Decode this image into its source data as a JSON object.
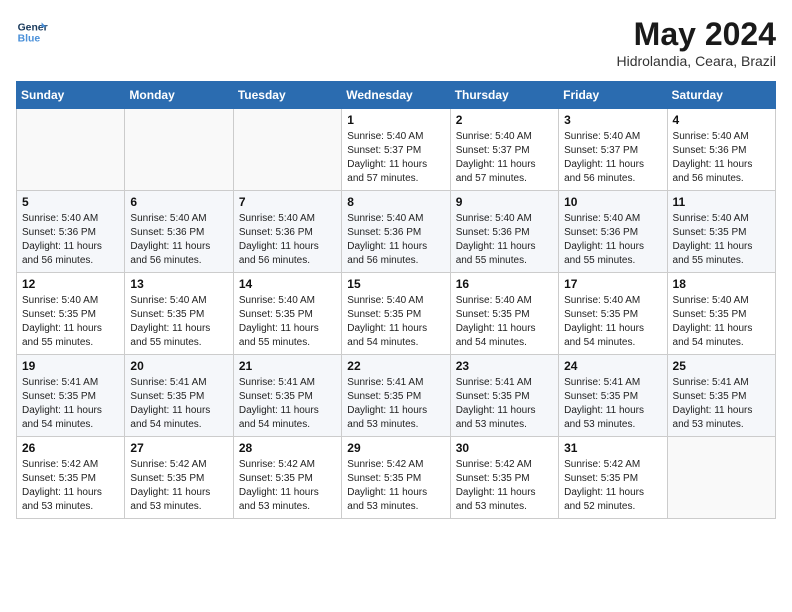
{
  "header": {
    "logo_line1": "General",
    "logo_line2": "Blue",
    "month_year": "May 2024",
    "location": "Hidrolandia, Ceara, Brazil"
  },
  "weekdays": [
    "Sunday",
    "Monday",
    "Tuesday",
    "Wednesday",
    "Thursday",
    "Friday",
    "Saturday"
  ],
  "weeks": [
    [
      {
        "day": "",
        "info": ""
      },
      {
        "day": "",
        "info": ""
      },
      {
        "day": "",
        "info": ""
      },
      {
        "day": "1",
        "info": "Sunrise: 5:40 AM\nSunset: 5:37 PM\nDaylight: 11 hours\nand 57 minutes."
      },
      {
        "day": "2",
        "info": "Sunrise: 5:40 AM\nSunset: 5:37 PM\nDaylight: 11 hours\nand 57 minutes."
      },
      {
        "day": "3",
        "info": "Sunrise: 5:40 AM\nSunset: 5:37 PM\nDaylight: 11 hours\nand 56 minutes."
      },
      {
        "day": "4",
        "info": "Sunrise: 5:40 AM\nSunset: 5:36 PM\nDaylight: 11 hours\nand 56 minutes."
      }
    ],
    [
      {
        "day": "5",
        "info": "Sunrise: 5:40 AM\nSunset: 5:36 PM\nDaylight: 11 hours\nand 56 minutes."
      },
      {
        "day": "6",
        "info": "Sunrise: 5:40 AM\nSunset: 5:36 PM\nDaylight: 11 hours\nand 56 minutes."
      },
      {
        "day": "7",
        "info": "Sunrise: 5:40 AM\nSunset: 5:36 PM\nDaylight: 11 hours\nand 56 minutes."
      },
      {
        "day": "8",
        "info": "Sunrise: 5:40 AM\nSunset: 5:36 PM\nDaylight: 11 hours\nand 56 minutes."
      },
      {
        "day": "9",
        "info": "Sunrise: 5:40 AM\nSunset: 5:36 PM\nDaylight: 11 hours\nand 55 minutes."
      },
      {
        "day": "10",
        "info": "Sunrise: 5:40 AM\nSunset: 5:36 PM\nDaylight: 11 hours\nand 55 minutes."
      },
      {
        "day": "11",
        "info": "Sunrise: 5:40 AM\nSunset: 5:35 PM\nDaylight: 11 hours\nand 55 minutes."
      }
    ],
    [
      {
        "day": "12",
        "info": "Sunrise: 5:40 AM\nSunset: 5:35 PM\nDaylight: 11 hours\nand 55 minutes."
      },
      {
        "day": "13",
        "info": "Sunrise: 5:40 AM\nSunset: 5:35 PM\nDaylight: 11 hours\nand 55 minutes."
      },
      {
        "day": "14",
        "info": "Sunrise: 5:40 AM\nSunset: 5:35 PM\nDaylight: 11 hours\nand 55 minutes."
      },
      {
        "day": "15",
        "info": "Sunrise: 5:40 AM\nSunset: 5:35 PM\nDaylight: 11 hours\nand 54 minutes."
      },
      {
        "day": "16",
        "info": "Sunrise: 5:40 AM\nSunset: 5:35 PM\nDaylight: 11 hours\nand 54 minutes."
      },
      {
        "day": "17",
        "info": "Sunrise: 5:40 AM\nSunset: 5:35 PM\nDaylight: 11 hours\nand 54 minutes."
      },
      {
        "day": "18",
        "info": "Sunrise: 5:40 AM\nSunset: 5:35 PM\nDaylight: 11 hours\nand 54 minutes."
      }
    ],
    [
      {
        "day": "19",
        "info": "Sunrise: 5:41 AM\nSunset: 5:35 PM\nDaylight: 11 hours\nand 54 minutes."
      },
      {
        "day": "20",
        "info": "Sunrise: 5:41 AM\nSunset: 5:35 PM\nDaylight: 11 hours\nand 54 minutes."
      },
      {
        "day": "21",
        "info": "Sunrise: 5:41 AM\nSunset: 5:35 PM\nDaylight: 11 hours\nand 54 minutes."
      },
      {
        "day": "22",
        "info": "Sunrise: 5:41 AM\nSunset: 5:35 PM\nDaylight: 11 hours\nand 53 minutes."
      },
      {
        "day": "23",
        "info": "Sunrise: 5:41 AM\nSunset: 5:35 PM\nDaylight: 11 hours\nand 53 minutes."
      },
      {
        "day": "24",
        "info": "Sunrise: 5:41 AM\nSunset: 5:35 PM\nDaylight: 11 hours\nand 53 minutes."
      },
      {
        "day": "25",
        "info": "Sunrise: 5:41 AM\nSunset: 5:35 PM\nDaylight: 11 hours\nand 53 minutes."
      }
    ],
    [
      {
        "day": "26",
        "info": "Sunrise: 5:42 AM\nSunset: 5:35 PM\nDaylight: 11 hours\nand 53 minutes."
      },
      {
        "day": "27",
        "info": "Sunrise: 5:42 AM\nSunset: 5:35 PM\nDaylight: 11 hours\nand 53 minutes."
      },
      {
        "day": "28",
        "info": "Sunrise: 5:42 AM\nSunset: 5:35 PM\nDaylight: 11 hours\nand 53 minutes."
      },
      {
        "day": "29",
        "info": "Sunrise: 5:42 AM\nSunset: 5:35 PM\nDaylight: 11 hours\nand 53 minutes."
      },
      {
        "day": "30",
        "info": "Sunrise: 5:42 AM\nSunset: 5:35 PM\nDaylight: 11 hours\nand 53 minutes."
      },
      {
        "day": "31",
        "info": "Sunrise: 5:42 AM\nSunset: 5:35 PM\nDaylight: 11 hours\nand 52 minutes."
      },
      {
        "day": "",
        "info": ""
      }
    ]
  ]
}
